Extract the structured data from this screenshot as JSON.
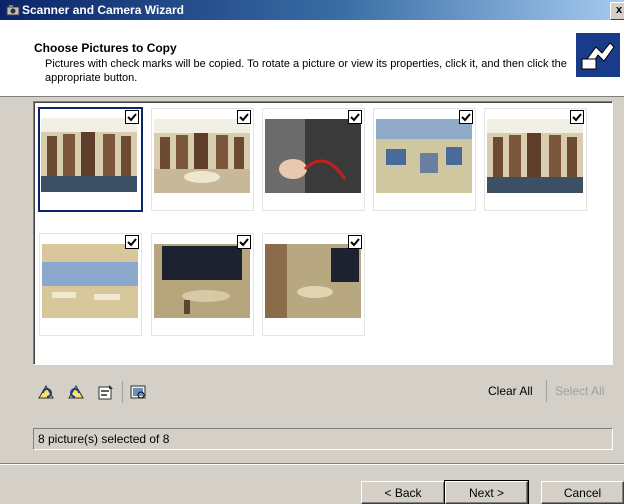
{
  "window": {
    "title": "Scanner and Camera Wizard",
    "close_glyph": "x"
  },
  "header": {
    "title": "Choose Pictures to Copy",
    "description": "Pictures with check marks will be copied. To rotate a picture or view its properties, click it, and then click the appropriate button."
  },
  "thumbnails": [
    {
      "selected": true,
      "checked": true
    },
    {
      "selected": false,
      "checked": true
    },
    {
      "selected": false,
      "checked": true
    },
    {
      "selected": false,
      "checked": true
    },
    {
      "selected": false,
      "checked": true
    },
    {
      "selected": false,
      "checked": true
    },
    {
      "selected": false,
      "checked": true
    },
    {
      "selected": false,
      "checked": true
    }
  ],
  "toolbar": {
    "icons": [
      "rotate-clockwise-icon",
      "rotate-counterclockwise-icon",
      "properties-icon",
      "preview-icon"
    ],
    "clear_all": "Clear All",
    "select_all": "Select All"
  },
  "status": {
    "text": "8 picture(s) selected of 8"
  },
  "buttons": {
    "back": "< Back",
    "next": "Next >",
    "cancel": "Cancel"
  }
}
